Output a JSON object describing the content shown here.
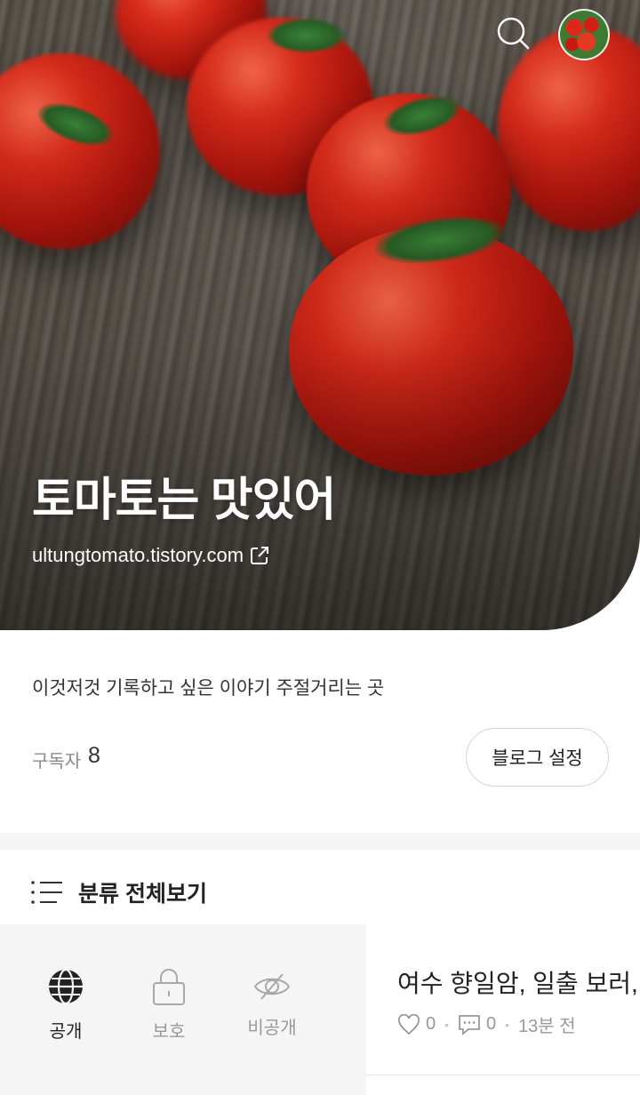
{
  "header": {
    "search_icon": "search-icon",
    "avatar_alt": "profile-avatar"
  },
  "blog": {
    "title": "토마토는 맛있어",
    "url": "ultungtomato.tistory.com",
    "description": "이것저것 기록하고 싶은 이야기 주절거리는 곳",
    "subscriber_label": "구독자",
    "subscriber_count": "8",
    "settings_label": "블로그 설정"
  },
  "category": {
    "label": "분류 전체보기"
  },
  "visibility": {
    "items": [
      {
        "label": "공개",
        "icon": "globe-icon",
        "active": true
      },
      {
        "label": "보호",
        "icon": "lock-icon",
        "active": false
      },
      {
        "label": "비공개",
        "icon": "eye-off-icon",
        "active": false
      }
    ]
  },
  "post": {
    "title": "여수 향일암, 일출 보러, 이",
    "likes": "0",
    "comments": "0",
    "time": "13분 전"
  },
  "colors": {
    "hero_text": "#ffffff",
    "accent_red": "#e22d1c",
    "panel_bg": "#f5f5f5"
  }
}
